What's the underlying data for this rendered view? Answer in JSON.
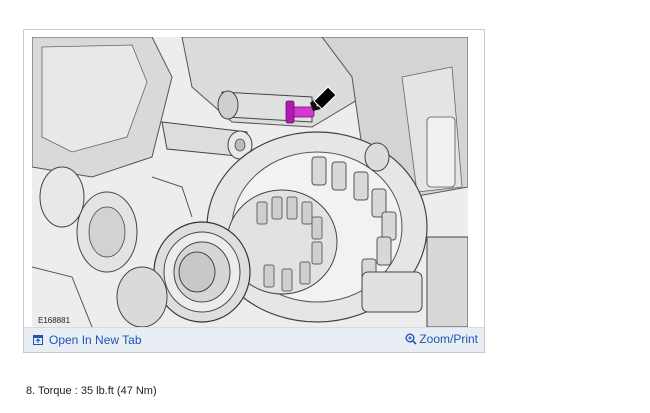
{
  "figure": {
    "image_id": "E168881",
    "open_tab_label": "Open In New Tab",
    "zoom_label": "Zoom/Print",
    "icons": {
      "open_tab": "open-new-tab-icon",
      "zoom": "magnifier-zoom-icon"
    },
    "colors": {
      "link": "#1a56b4",
      "toolbar_bg": "#e9eef5",
      "highlight_bolt": "#c020c0"
    }
  },
  "step": {
    "text": "8. Torque : 35 lb.ft (47 Nm)"
  }
}
